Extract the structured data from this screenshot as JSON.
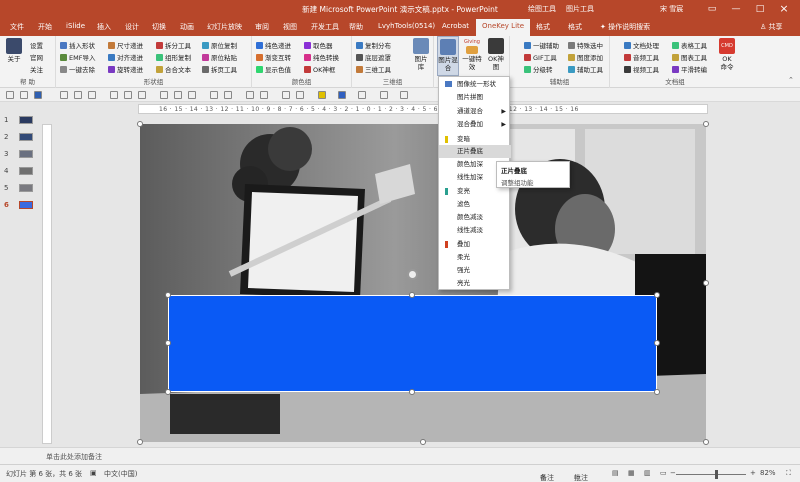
{
  "titlebar": {
    "title": "新建 Microsoft PowerPoint 演示文稿.pptx - PowerPoint",
    "context_left": "绘图工具",
    "context_right": "图片工具",
    "user": "宋 雪宸"
  },
  "tabs": [
    "文件",
    "开始",
    "iSlide",
    "插入",
    "设计",
    "切换",
    "动画",
    "幻灯片放映",
    "审阅",
    "视图",
    "开发工具",
    "帮助",
    "LvyhTools(0514)",
    "Acrobat",
    "OneKey Lite",
    "格式",
    "格式"
  ],
  "tell_me": "操作说明搜索",
  "share": "共享",
  "ribbon": {
    "about": [
      "设置",
      "官网",
      "关注"
    ],
    "about_big": "关于",
    "help_label": "帮 助",
    "shape_col1": [
      "插入形状",
      "EMF导入",
      "一键去除"
    ],
    "shape_col2": [
      "尺寸递进",
      "对齐递进",
      "旋转递进"
    ],
    "shape_col3": [
      "拆分工具",
      "组形复制",
      "合合文本"
    ],
    "shape_col4": [
      "原位复制",
      "原位粘贴",
      "拆页工具"
    ],
    "shape_label": "形状组",
    "color_col1": [
      "纯色递进",
      "渐变互转",
      "显示色值"
    ],
    "color_col2": [
      "取色器",
      "纯色转换",
      "OK神框"
    ],
    "color_label": "颜色组",
    "three_col": [
      "复制分布",
      "底层遮罩",
      "三维工具"
    ],
    "three_label": "三维组",
    "pic_big": [
      "图片混",
      "合"
    ],
    "pic_gif": "Giving",
    "pic_onekey": [
      "一键特",
      "效"
    ],
    "pic_okshow": [
      "OK神",
      "图"
    ],
    "pic_library": [
      "图片",
      "库"
    ],
    "aux_col1": [
      "一键辅助",
      "GIF工具",
      "分级转"
    ],
    "aux_col2": [
      "特殊选中",
      "图度添加",
      "辅助工具"
    ],
    "aux_label": "辅助组",
    "doc_col1": [
      "文档处理",
      "音频工具",
      "视频工具"
    ],
    "doc_col2": [
      "表格工具",
      "图表工具",
      "平滑转编"
    ],
    "doc_big": [
      "OK",
      "命令"
    ],
    "doc_label": "文档组"
  },
  "thumbnails": [
    "1",
    "2",
    "3",
    "4",
    "5",
    "6"
  ],
  "ruler_numbers": "16 · 15 · 14 · 13 · 12 · 11 · 10 · 9 · 8 · 7 · 6 · 5 · 4 · 3 · 2 · 1 · 0 · 1 · 2 · 3 · 4 · 5 · 6 · 7 · 8 · 9 · 10 · 11 · 12 · 13 · 14 · 15 · 16",
  "menu": {
    "items": [
      "图像统一形状",
      "图片拼图",
      "通道混合",
      "混合叠加",
      "变暗",
      "正片叠底",
      "颜色加深",
      "线性加深",
      "变亮",
      "滤色",
      "颜色减淡",
      "线性减淡",
      "叠加",
      "柔光",
      "强光",
      "亮光"
    ],
    "highlighted": "正片叠底",
    "submenu": [
      "正片叠底",
      "调整组功能"
    ]
  },
  "colors": {
    "brand": "#b7472a",
    "shape_fill": "#0a5af5"
  },
  "notes_placeholder": "单击此处添加备注",
  "status": {
    "slide": "幻灯片 第 6 张，共 6 张",
    "lang": "中文(中国)",
    "notes": "备注",
    "comments": "批注",
    "zoom": "82%"
  }
}
